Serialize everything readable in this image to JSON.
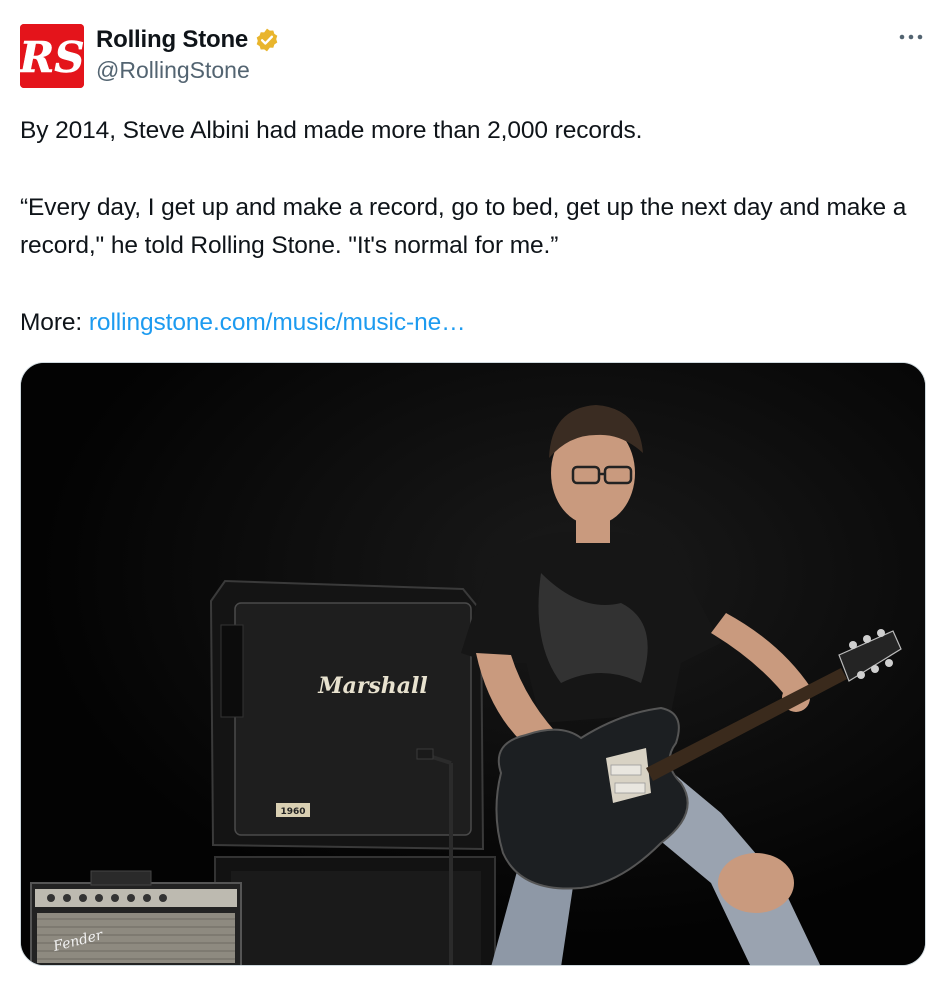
{
  "account": {
    "display_name": "Rolling Stone",
    "handle": "@RollingStone",
    "avatar_logo": "RS",
    "verified_badge_color": "#f4b400"
  },
  "tweet": {
    "line1": "By 2014, Steve Albini had made more than 2,000 records.",
    "quote": "“Every day, I get up and make a record, go to bed, get up the next day and make a record,\" he told Rolling Stone. \"It's normal for me.”",
    "more_label": "More:",
    "link_text": "rollingstone.com/music/music-ne…"
  },
  "media": {
    "amp_brand": "Marshall",
    "amp_model": "1960",
    "combo_brand": "Fender"
  },
  "icons": {
    "more": "more-options-icon",
    "verified": "verified-badge-icon"
  },
  "colors": {
    "brand_red": "#e4141b",
    "link_blue": "#1d9bf0",
    "secondary_text": "#536471"
  }
}
